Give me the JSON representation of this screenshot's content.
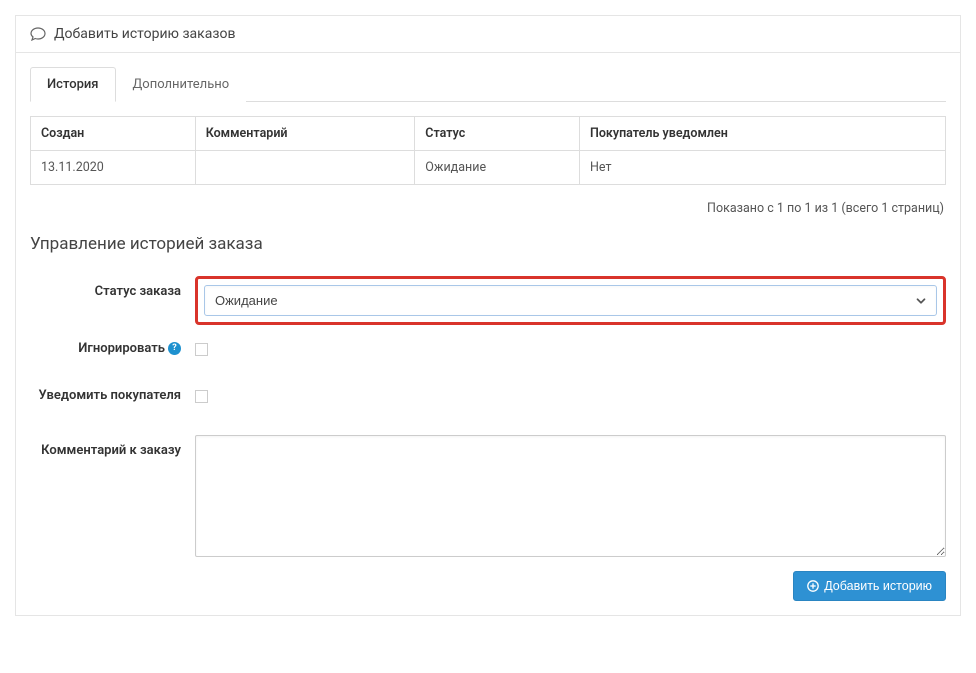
{
  "panel": {
    "title": "Добавить историю заказов"
  },
  "tabs": [
    {
      "label": "История",
      "active": true
    },
    {
      "label": "Дополнительно",
      "active": false
    }
  ],
  "table": {
    "headers": {
      "created": "Создан",
      "comment": "Комментарий",
      "status": "Статус",
      "notified": "Покупатель уведомлен"
    },
    "rows": [
      {
        "created": "13.11.2020",
        "comment": "",
        "status": "Ожидание",
        "notified": "Нет"
      }
    ]
  },
  "pagination": "Показано с 1 по 1 из 1 (всего 1 страниц)",
  "section": {
    "title": "Управление историей заказа"
  },
  "form": {
    "status": {
      "label": "Статус заказа",
      "value": "Ожидание"
    },
    "ignore": {
      "label": "Игнорировать"
    },
    "notify": {
      "label": "Уведомить покупателя"
    },
    "comment": {
      "label": "Комментарий к заказу",
      "value": ""
    },
    "submit": "Добавить историю"
  }
}
